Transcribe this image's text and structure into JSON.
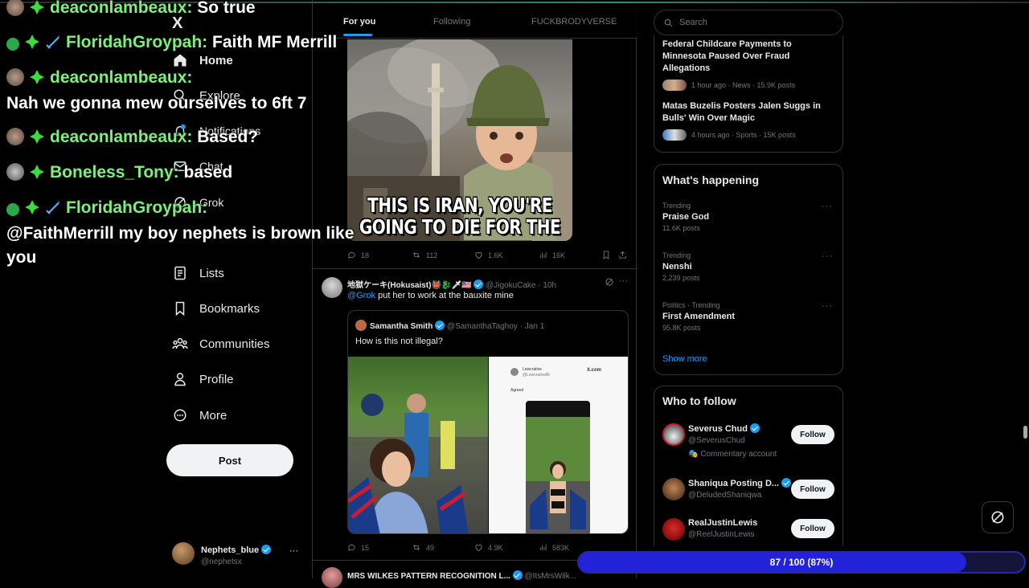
{
  "nav": {
    "logo": "X",
    "items": [
      {
        "label": "Home",
        "icon": "home-icon"
      },
      {
        "label": "Explore",
        "icon": "search-icon"
      },
      {
        "label": "Notifications",
        "icon": "bell-icon"
      },
      {
        "label": "Chat",
        "icon": "mail-icon"
      },
      {
        "label": "Grok",
        "icon": "grok-icon"
      },
      {
        "label": "Lists",
        "icon": "list-icon"
      },
      {
        "label": "Bookmarks",
        "icon": "bookmark-icon"
      },
      {
        "label": "Communities",
        "icon": "people-icon"
      },
      {
        "label": "Profile",
        "icon": "person-icon"
      },
      {
        "label": "More",
        "icon": "more-circle-icon"
      }
    ],
    "post_label": "Post",
    "account": {
      "name": "Nephets_blue",
      "handle": "@nephetsx",
      "more": "···"
    }
  },
  "tabs": [
    {
      "label": "For you",
      "active": true
    },
    {
      "label": "Following",
      "active": false
    },
    {
      "label": "FUCKBRODYVERSE",
      "active": false
    }
  ],
  "tweet1": {
    "image_caption": "THIS IS IRAN, YOU'RE GOING TO DIE FOR THE JEWS",
    "caption_line1": "THIS IS IRAN, YOU'RE",
    "caption_line2": "GOING TO DIE FOR THE JEWS",
    "replies": "18",
    "reposts": "112",
    "likes": "1.6K",
    "views": "16K"
  },
  "tweet2": {
    "author": "地獄ケーキ(Hokusaist)👹🐉🗡🇺🇸",
    "handle": "@JigokuCake",
    "time": "· 10h",
    "mention": "@Grok",
    "text": "put her to work at the bauxite mine",
    "quote": {
      "author": "Samantha Smith",
      "handle": "@SamanthaTaghoy",
      "time": "· Jan 1",
      "text": "How is this not illegal?",
      "screenshot_user": "Lewcrative",
      "screenshot_handle": "@LewcrativeBt",
      "screenshot_site": "X.com",
      "screenshot_text": "Agreed"
    },
    "replies": "15",
    "reposts": "49",
    "likes": "4.9K",
    "views": "583K"
  },
  "tweet3": {
    "author": "MRS WILKES PATTERN RECOGNITION L...",
    "handle": "@ItsMrsWilk..."
  },
  "search": {
    "placeholder": "Search"
  },
  "news": [
    {
      "title": "Federal Childcare Payments to Minnesota Paused Over Fraud Allegations",
      "meta": "1 hour ago · News · 15.9K posts"
    },
    {
      "title": "Matas Buzelis Posters Jalen Suggs in Bulls' Win Over Magic",
      "meta": "4 hours ago · Sports · 15K posts"
    }
  ],
  "whats_happening": {
    "title": "What's happening",
    "trends": [
      {
        "context": "Trending",
        "name": "Praise God",
        "count": "11.6K posts"
      },
      {
        "context": "Trending",
        "name": "Nenshi",
        "count": "2,239 posts"
      },
      {
        "context": "Politics · Trending",
        "name": "First Amendment",
        "count": "95.8K posts"
      }
    ],
    "show_more": "Show more"
  },
  "who_to_follow": {
    "title": "Who to follow",
    "accounts": [
      {
        "name": "Severus Chud",
        "handle": "@SeverusChud",
        "extra": "Commentary account",
        "button": "Follow"
      },
      {
        "name": "Shaniqua Posting D...",
        "handle": "@DeludedShaniqwa",
        "extra": "",
        "button": "Follow"
      },
      {
        "name": "RealJustinLewis",
        "handle": "@ReelJustinLewis",
        "extra": "",
        "button": "Follow"
      }
    ]
  },
  "chat": [
    {
      "user": "deaconlambeaux:",
      "message": "So true"
    },
    {
      "user": "FloridahGroypah:",
      "message": "Faith MF Merrill"
    },
    {
      "user": "deaconlambeaux:",
      "message": "Nah we gonna mew ourselves to 6ft 7"
    },
    {
      "user": "deaconlambeaux:",
      "message": "Based?"
    },
    {
      "user": "Boneless_Tony:",
      "message": "based"
    },
    {
      "user": "FloridahGroypah:",
      "message": "@FaithMerrill my boy nephets is brown like you"
    }
  ],
  "chat_message_line1": "@FaithMerrill my boy nephets is brown like",
  "chat_message_line2": "you",
  "progress": {
    "label": "87 / 100 (87%)",
    "value": 87,
    "max": 100
  },
  "colors": {
    "accent": "#1d9bf0",
    "chat_user": "#7cf17a",
    "progress": "#2222d8"
  }
}
